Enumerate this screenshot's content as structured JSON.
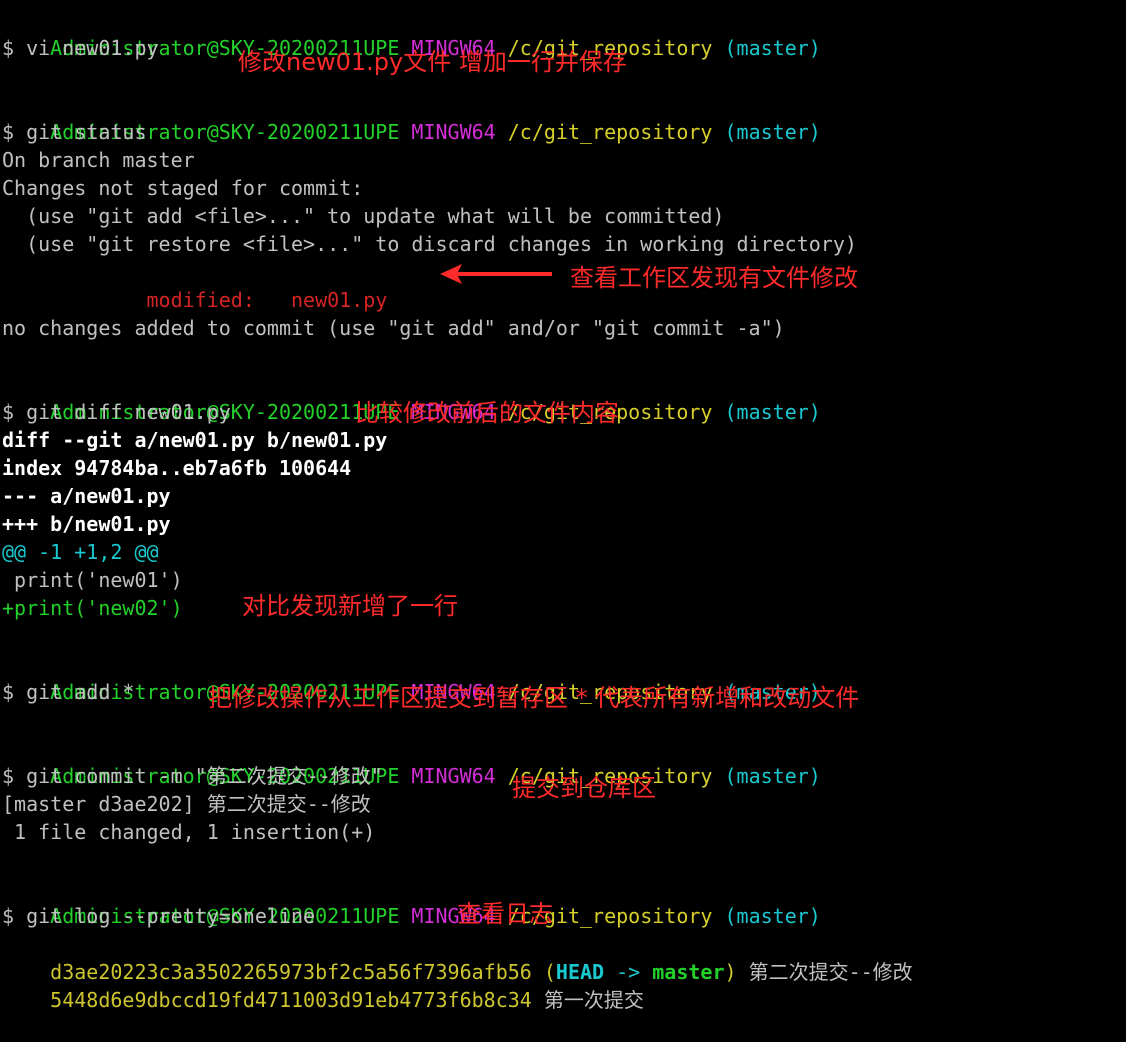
{
  "prompt": {
    "user": "Administrator@SKY-20200211UPE",
    "shell": "MINGW64",
    "path": "/c/git_repository",
    "branch": "(master)"
  },
  "blocks": {
    "vi": {
      "cmd": "$ vi new01.py",
      "note": "修改new01.py文件 增加一行并保存"
    },
    "status": {
      "cmd": "$ git status",
      "out1": "On branch master",
      "out2": "Changes not staged for commit:",
      "out3": "  (use \"git add <file>...\" to update what will be committed)",
      "out4": "  (use \"git restore <file>...\" to discard changes in working directory)",
      "modified_label": "        modified:   ",
      "modified_file": "new01.py",
      "out6": "no changes added to commit (use \"git add\" and/or \"git commit -a\")",
      "note": "查看工作区发现有文件修改"
    },
    "diff": {
      "cmd": "$ git diff new01.py",
      "note": "比较修改前后的文件内容",
      "header1": "diff --git a/new01.py b/new01.py",
      "header2": "index 94784ba..eb7a6fb 100644",
      "header3": "--- a/new01.py",
      "header4": "+++ b/new01.py",
      "hunk": "@@ -1 +1,2 @@",
      "context": " print('new01')",
      "added": "+print('new02')",
      "note2": "对比发现新增了一行"
    },
    "add": {
      "cmd": "$ git add *",
      "note": "把修改操作从工作区提交到暂存区 * 代表所有新增和改动文件"
    },
    "commit": {
      "cmd": "$ git commit -m \"第二次提交--修改\"",
      "note": "提交到仓库区",
      "out1": "[master d3ae202] 第二次提交--修改",
      "out2": " 1 file changed, 1 insertion(+)"
    },
    "log": {
      "cmd": "$ git log --pretty=oneline",
      "note": "查看日志",
      "hash1": "d3ae20223c3a3502265973bf2c5a56f7396afb56",
      "head_open": " (",
      "head": "HEAD",
      "head_arrow": " -> ",
      "head_branch": "master",
      "head_close": ")",
      "msg1": " 第二次提交--修改",
      "hash2": "5448d6e9dbccd19fd4711003d91eb4773f6b8c34",
      "msg2": " 第一次提交"
    }
  },
  "colors": {
    "background": "#000000",
    "user": "#23d12b",
    "shell": "#d52dd8",
    "path": "#d6d02a",
    "branch": "#19c9cf",
    "annotation": "#ff2a2a"
  }
}
